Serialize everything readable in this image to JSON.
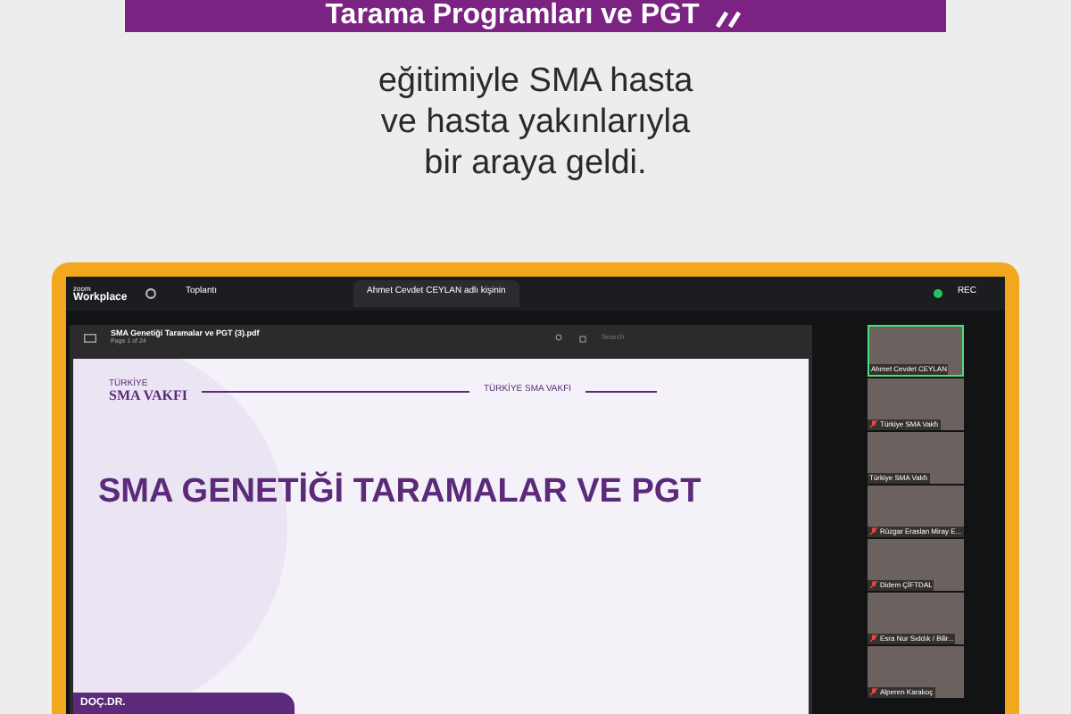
{
  "headline": {
    "title": "Tarama Programları ve PGT",
    "subtitle_lines": [
      "eğitimiyle SMA hasta",
      "ve hasta yakınlarıyla",
      "bir araya geldi."
    ]
  },
  "meeting_window": {
    "brand_small": "zoom",
    "brand": "Workplace",
    "tabs": [
      {
        "label": "Toplantı",
        "selected": false
      },
      {
        "label": "Ahmet Cevdet CEYLAN adlı kişinin",
        "selected": true
      }
    ],
    "rec": "REC",
    "pdf": {
      "filename": "SMA Genetiği Taramalar ve PGT (3).pdf",
      "page": "Page 1 of 24",
      "search_placeholder": "Search",
      "slide": {
        "logo_small": "TÜRKİYE",
        "logo": "SMA VAKFI",
        "header_label": "TÜRKİYE SMA VAKFI",
        "title": "SMA GENETİĞİ TARAMALAR VE PGT",
        "presenter": "DOÇ.DR."
      }
    },
    "participants": [
      {
        "name": "Ahmet Cevdet CEYLAN",
        "muted": false,
        "speaking": true
      },
      {
        "name": "Türkiye SMA Vakfı",
        "muted": true,
        "speaking": false
      },
      {
        "name": "Türkiye SMA Vakfı",
        "muted": false,
        "speaking": false
      },
      {
        "name": "Rüzgar Eraslan Miray E...",
        "muted": true,
        "speaking": false
      },
      {
        "name": "Didem ÇİFTDAL",
        "muted": true,
        "speaking": false
      },
      {
        "name": "Esra Nur Sıddık / Bilir...",
        "muted": true,
        "speaking": false
      },
      {
        "name": "Alperen Karakoç",
        "muted": true,
        "speaking": false
      }
    ]
  }
}
